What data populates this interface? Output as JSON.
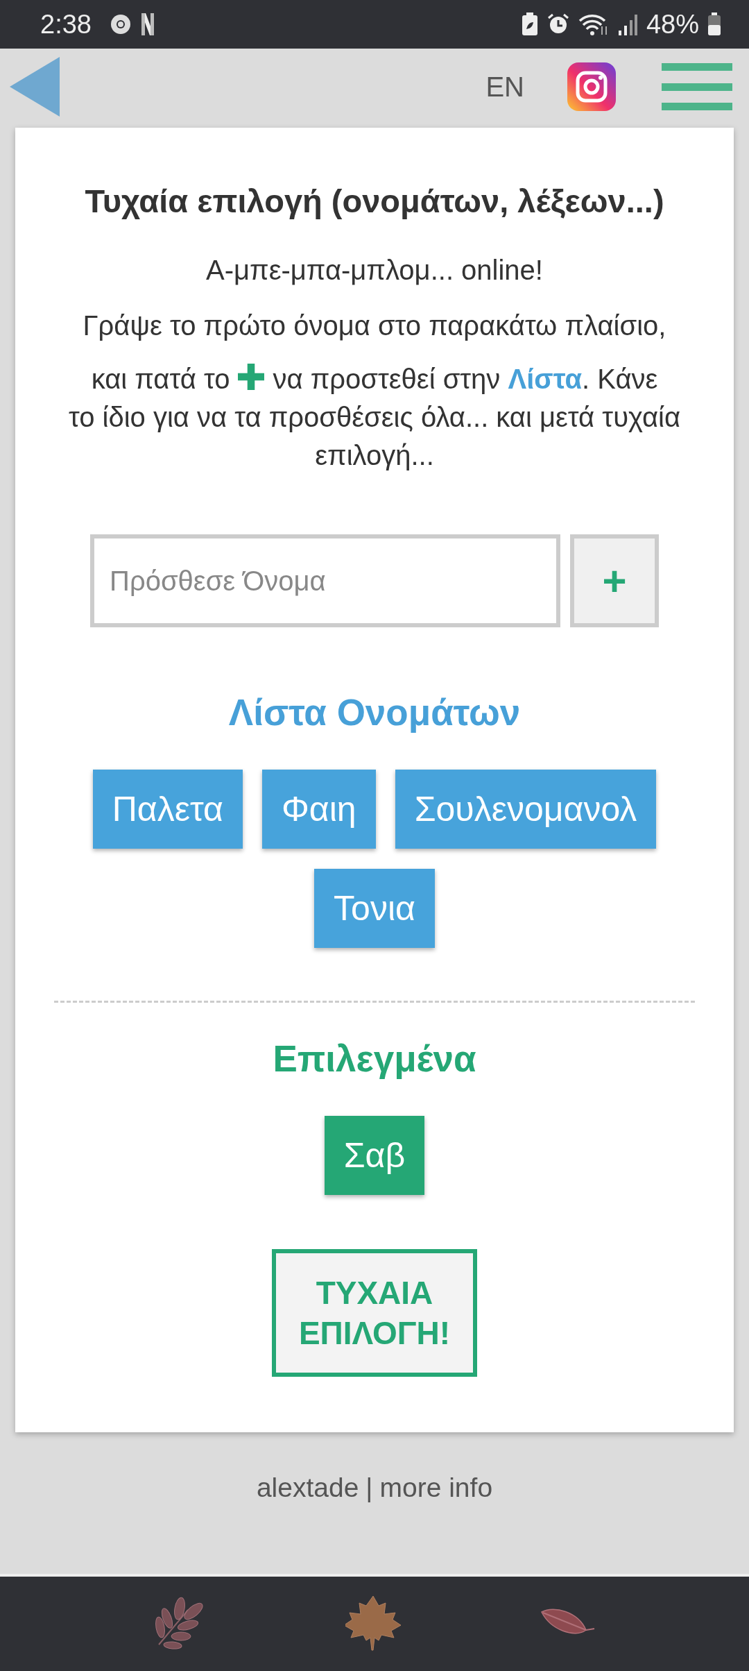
{
  "status_bar": {
    "time": "2:38",
    "battery": "48%"
  },
  "header": {
    "language": "EN"
  },
  "card": {
    "title": "Τυχαία επιλογή (ονομάτων, λέξεων...)",
    "subtitle": "Α-μπε-μπα-μπλομ... online!",
    "instruction_line": "Γράψε το πρώτο όνομα στο παρακάτω πλαίσιο,",
    "instruction_before": "και πατά το",
    "instruction_after": "να προστεθεί στην **Λίστα**. Κάνε",
    "instruction_rest": "το ίδιο για να τα προσθέσεις όλα... και μετά τυχαία επιλογή...",
    "input": {
      "placeholder": "Πρόσθεσε Όνομα"
    },
    "add_button": "+",
    "list_heading": "Λίστα Ονομάτων",
    "names": [
      "Παλετα",
      "Φαιη",
      "Σουλενομανολ",
      "Τονια"
    ],
    "selected_heading": "Επιλεγμένα",
    "selected": [
      "Σαβ"
    ],
    "random_button": "ΤΥΧΑΙΑ ΕΠΙΛΟΓΗ!"
  },
  "footer": {
    "author": "alextade",
    "separator": "|",
    "link": "more info"
  }
}
